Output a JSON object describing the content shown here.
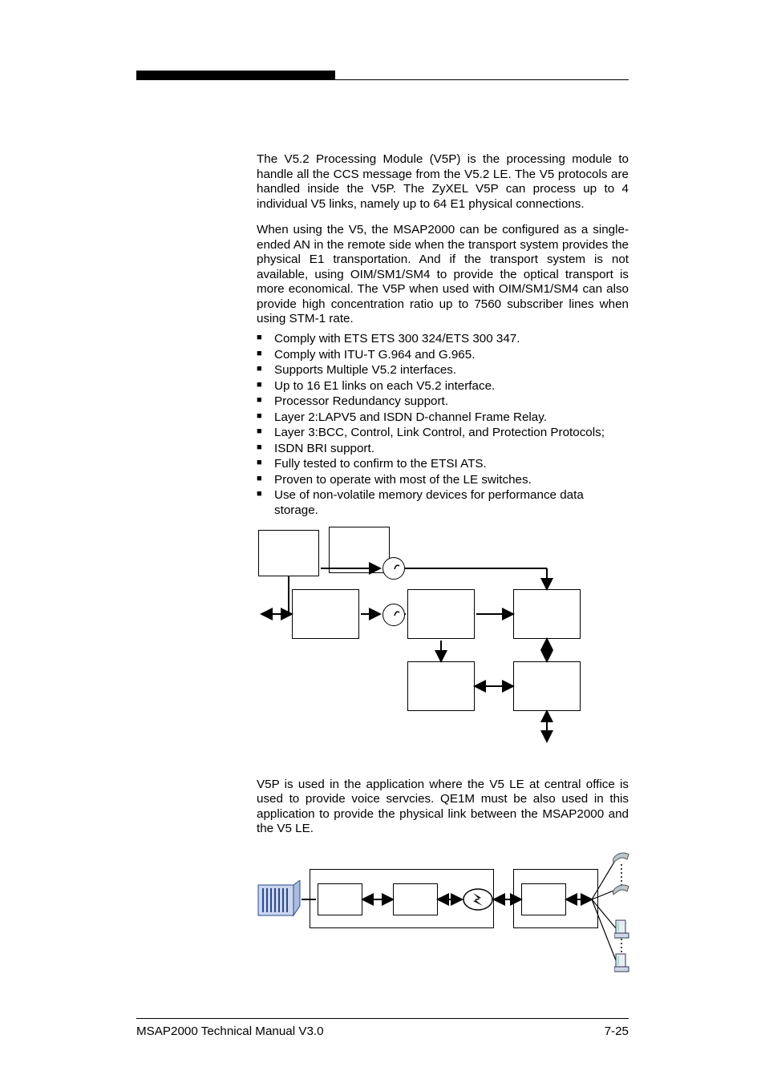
{
  "paragraph1": "The V5.2 Processing Module (V5P) is the processing module to handle all the CCS message from the V5.2 LE. The V5 protocols are handled inside the V5P. The ZyXEL V5P can process up to 4 individual V5 links, namely up to 64 E1 physical connections.",
  "paragraph2": "When using the V5, the MSAP2000 can be configured as a single-ended AN in the remote side when the transport system provides the physical E1 transportation. And if the transport system is not available, using OIM/SM1/SM4 to provide the optical transport is more economical. The V5P when used with OIM/SM1/SM4 can also provide high concentration ratio up to 7560 subscriber lines when using STM-1 rate.",
  "bullets": [
    "Comply with ETS ETS 300 324/ETS 300 347.",
    "Comply with ITU-T G.964 and G.965.",
    "Supports Multiple V5.2 interfaces.",
    "Up to 16 E1 links on each V5.2 interface.",
    "Processor Redundancy support.",
    "Layer 2:LAPV5 and ISDN D-channel Frame Relay.",
    "Layer 3:BCC, Control, Link Control, and Protection Protocols;",
    "ISDN BRI support.",
    "Fully tested to confirm to the ETSI ATS.",
    "Proven to operate with most of the LE switches.",
    "Use of non-volatile memory devices for performance data storage."
  ],
  "paragraph3": "V5P is used in the application where the V5 LE  at central office is used to provide voice servcies. QE1M must be also used in this application to provide the physical link between the MSAP2000 and the V5 LE.",
  "footer_left": "MSAP2000 Technical Manual V3.0",
  "footer_right": "7-25"
}
